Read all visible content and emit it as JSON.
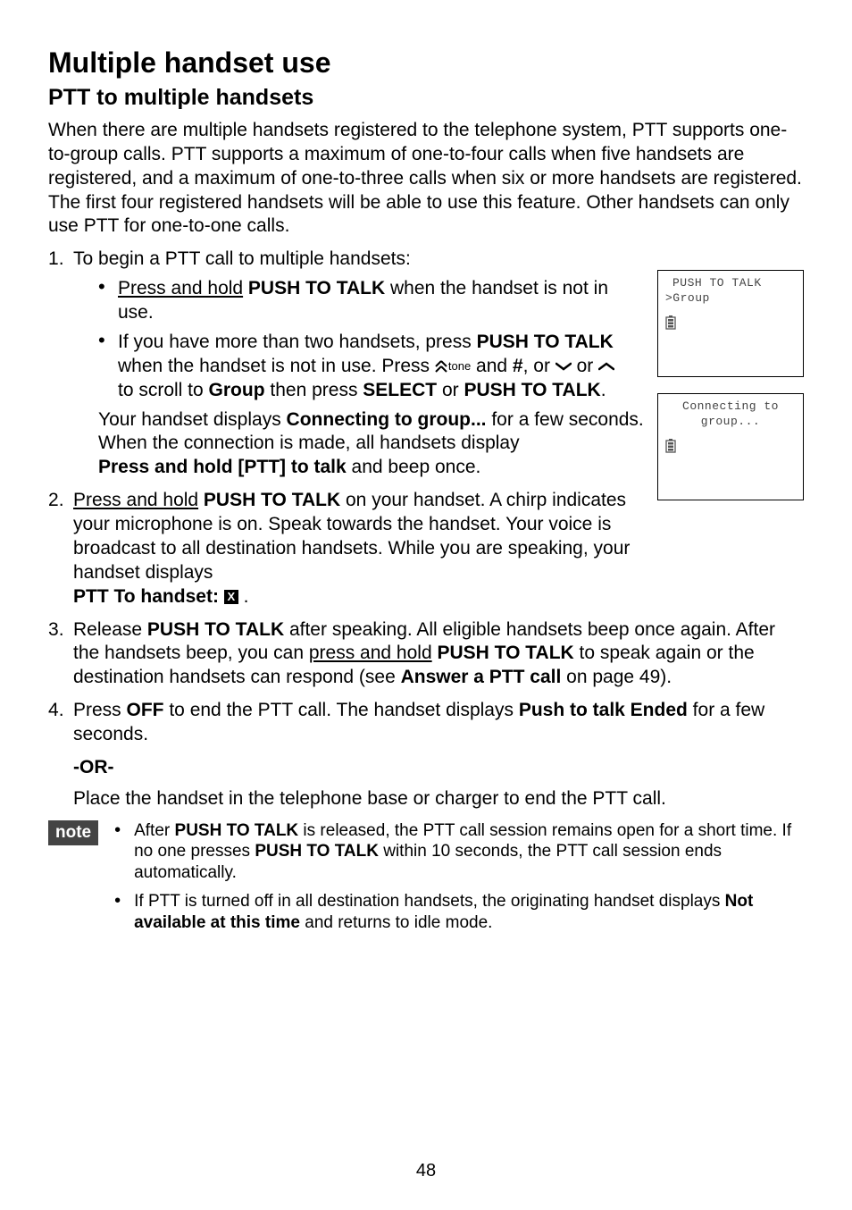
{
  "title": "Multiple handset use",
  "subtitle": "PTT to multiple handsets",
  "intro": "When there are multiple handsets registered to the telephone system, PTT supports one-to-group calls. PTT supports a maximum of one-to-four calls when five handsets are registered, and a maximum of one-to-three calls when six or more handsets are registered. The first four registered handsets will be able to use this feature. Other handsets can only use PTT for one-to-one calls.",
  "step1_lead": "To begin a PTT call to multiple handsets:",
  "step1_a_pre": "Press and hold",
  "step1_a_bold": " PUSH TO TALK ",
  "step1_a_post": "when the handset is not in use.",
  "step1_b_pre": "If you have more than two handsets, press ",
  "step1_b_b1": "PUSH TO TALK",
  "step1_b_mid1": " when the handset is not in use. Press ",
  "tone_label": "tone",
  "step1_b_mid2": " and ",
  "step1_b_hash": "#",
  "step1_b_mid3": ", or ",
  "step1_b_mid4": " or ",
  "step1_b_mid5": " to scroll to ",
  "step1_b_group": "Group",
  "step1_b_mid6": " then press ",
  "step1_b_select": "SELECT",
  "step1_b_mid7": " or ",
  "step1_b_ptt": "PUSH TO TALK",
  "period": ".",
  "step1_result_a": "Your handset displays ",
  "step1_result_b": "Connecting to group...",
  "step1_result_c": " for a few seconds. When the connection is made, all handsets display ",
  "step1_result_d": "Press and hold [PTT] to talk",
  "step1_result_e": " and beep once.",
  "step2_a": "Press and hold",
  "step2_b": " PUSH TO TALK ",
  "step2_c": "on your handset. A chirp indicates your microphone is on. Speak towards the handset. Your voice is broadcast to all destination handsets. While you are speaking, your handset displays ",
  "step2_d": "PTT To handset: ",
  "step2_box": "X",
  "step2_e": " .",
  "step3_a": "Release ",
  "step3_b": "PUSH TO TALK",
  "step3_c": " after speaking. All eligible handsets beep once again. After the handsets beep, you can ",
  "step3_d": "press and hold",
  "step3_e": " PUSH TO TALK ",
  "step3_f": "to speak again or the destination handsets can respond (see ",
  "step3_g": "Answer a PTT call",
  "step3_h": " on page 49).",
  "step4_a": "Press ",
  "step4_b": "OFF",
  "step4_c": " to end the PTT call. The handset displays ",
  "step4_d": "Push to talk Ended",
  "step4_e": " for a few seconds.",
  "or_text": "-OR-",
  "step4_alt": "Place the handset in the telephone base or charger to end the PTT call.",
  "note_label": "note",
  "note1_a": "After ",
  "note1_b": "PUSH TO TALK",
  "note1_c": " is released, the PTT call session remains open for a short time. If no one presses ",
  "note1_d": "PUSH TO TALK",
  "note1_e": " within 10 seconds, the PTT call session ends automatically.",
  "note2_a": "If PTT is turned off in all destination handsets, the originating handset displays ",
  "note2_b": "Not available at this time",
  "note2_c": " and returns to idle mode.",
  "screen1_l1": "PUSH TO TALK",
  "screen1_l2": ">Group",
  "screen2_l1": "Connecting to",
  "screen2_l2": "group...",
  "pagenum": "48"
}
